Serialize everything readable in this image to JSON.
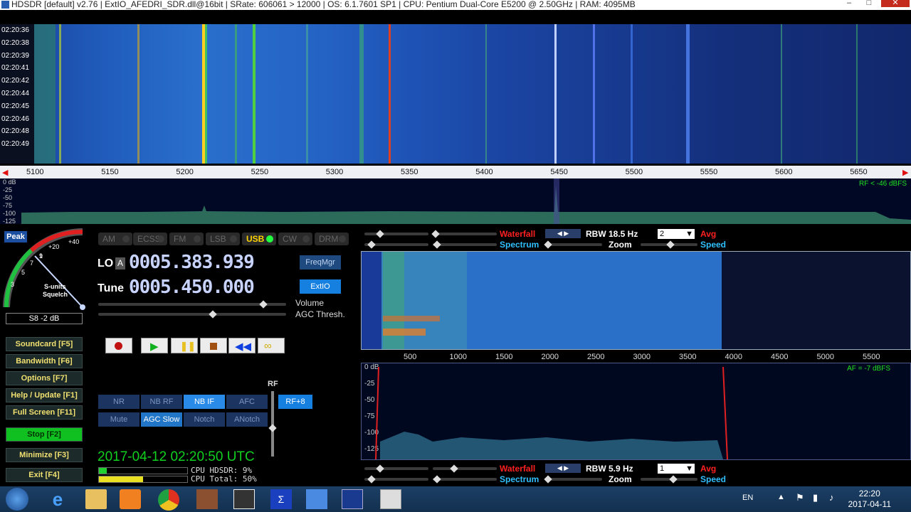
{
  "window": {
    "title": "HDSDR  [default]  v2.76    |  ExtIO_AFEDRI_SDR.dll@16bit  |  SRate: 606061 > 12000  |  OS: 6.1.7601 SP1  |  CPU: Pentium Dual-Core       E5200  @ 2.50GHz  |  RAM: 4095MB"
  },
  "waterfall_top": {
    "timestamps": [
      "02:20:36",
      "02:20:38",
      "02:20:39",
      "02:20:41",
      "02:20:42",
      "02:20:44",
      "02:20:45",
      "02:20:46",
      "02:20:48",
      "02:20:49"
    ],
    "freq_ticks": [
      "5100",
      "5150",
      "5200",
      "5250",
      "5300",
      "5350",
      "5400",
      "5450",
      "5500",
      "5550",
      "5600",
      "5650"
    ],
    "db_ticks": [
      "0 dB",
      "-25",
      "-50",
      "-75",
      "-100",
      "-125"
    ],
    "rf_level": "RF < -46 dBFS"
  },
  "smeter": {
    "peak_label": "Peak",
    "scale": [
      "1",
      "3",
      "5",
      "7",
      "9",
      "+20",
      "+40"
    ],
    "center_label": "S-units",
    "squelch_label": "Squelch",
    "reading": "S8 -2 dB"
  },
  "modes": [
    {
      "label": "AM",
      "active": false
    },
    {
      "label": "ECSS",
      "active": false
    },
    {
      "label": "FM",
      "active": false
    },
    {
      "label": "LSB",
      "active": false
    },
    {
      "label": "USB",
      "active": true
    },
    {
      "label": "CW",
      "active": false
    },
    {
      "label": "DRM",
      "active": false
    }
  ],
  "freq": {
    "lo_label": "LO",
    "lo_letter": "A",
    "lo_value": "0005.383.939",
    "tune_label": "Tune",
    "tune_value": "0005.450.000",
    "freqmgr": "FreqMgr",
    "extio": "ExtIO",
    "volume_label": "Volume",
    "agc_label": "AGC Thresh."
  },
  "sidebar": [
    {
      "label": "Soundcard [F5]"
    },
    {
      "label": "Bandwidth [F6]"
    },
    {
      "label": "Options [F7]"
    },
    {
      "label": "Help / Update [F1]"
    },
    {
      "label": "Full Screen [F11]"
    },
    {
      "label": "Stop [F2]"
    },
    {
      "label": "Minimize [F3]"
    },
    {
      "label": "Exit [F4]"
    }
  ],
  "dsp": {
    "rf_label": "RF",
    "buttons": [
      "NR",
      "NB RF",
      "NB IF",
      "AFC",
      "Mute",
      "AGC Slow",
      "Notch",
      "ANotch"
    ],
    "rf_gain": "RF+8"
  },
  "status": {
    "datetime": "2017-04-12   02:20:50 UTC",
    "cpu_hdsdr": "CPU HDSDR:  9%",
    "cpu_total": "CPU Total: 50%",
    "cpu_hdsdr_pct": 9,
    "cpu_total_pct": 50
  },
  "af_panel": {
    "waterfall_label": "Waterfall",
    "spectrum_label": "Spectrum",
    "rbw_top": "RBW 18.5 Hz",
    "zoom_label": "Zoom",
    "avg_label": "Avg",
    "speed_label": "Speed",
    "dropdown_top": "2",
    "freq_ticks": [
      "500",
      "1000",
      "1500",
      "2000",
      "2500",
      "3000",
      "3500",
      "4000",
      "4500",
      "5000",
      "5500"
    ],
    "db_ticks": [
      "0 dB",
      "-25",
      "-50",
      "-75",
      "-100",
      "-125"
    ],
    "af_level": "AF = -7 dBFS",
    "rbw_bottom": "RBW  5.9 Hz",
    "dropdown_bottom": "1"
  },
  "taskbar": {
    "lang": "EN",
    "time": "22:20",
    "date": "2017-04-11"
  },
  "colors": {
    "accent_blue": "#1680e0",
    "stop_green": "#10c020",
    "freq_text": "#c8d4ff",
    "waterfall_red": "#ff2020"
  }
}
